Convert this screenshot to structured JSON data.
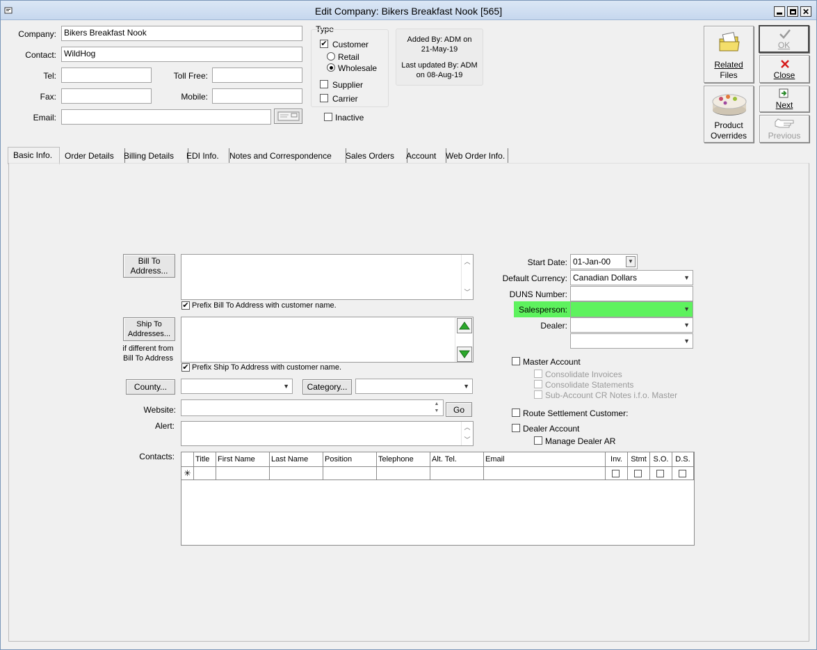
{
  "window": {
    "title": "Edit Company: Bikers Breakfast Nook [565]"
  },
  "header": {
    "company_label": "Company:",
    "company_value": "Bikers Breakfast Nook",
    "contact_label": "Contact:",
    "contact_value": "WildHog",
    "tel_label": "Tel:",
    "tel_value": "",
    "tollfree_label": "Toll Free:",
    "tollfree_value": "",
    "fax_label": "Fax:",
    "fax_value": "",
    "mobile_label": "Mobile:",
    "mobile_value": "",
    "email_label": "Email:",
    "email_value": ""
  },
  "type_group": {
    "title": "Type",
    "customer": "Customer",
    "customer_checked": "✔",
    "retail": "Retail",
    "wholesale": "Wholesale",
    "supplier": "Supplier",
    "carrier": "Carrier",
    "inactive": "Inactive"
  },
  "audit": {
    "added_by": "Added By: ADM on",
    "added_date": "21-May-19",
    "updated_by": "Last updated By: ADM",
    "updated_date": "on 08-Aug-19"
  },
  "toolbar": {
    "related_files": [
      "Related",
      "Files"
    ],
    "product_overrides": [
      "Product",
      "Overrides"
    ],
    "ok": "OK",
    "close": "Close",
    "next": "Next",
    "previous": "Previous"
  },
  "tabs": [
    "Basic Info.",
    "Order Details",
    "Billing Details",
    "EDI Info.",
    "Notes and Correspondence",
    "Sales Orders",
    "Account",
    "Web Order Info."
  ],
  "basic": {
    "bill_to_button": [
      "Bill To",
      "Address..."
    ],
    "bill_to_value": "",
    "prefix_bill": "Prefix Bill To Address with customer name.",
    "ship_to_button": [
      "Ship To",
      "Addresses..."
    ],
    "ship_to_note": [
      "if different from",
      "Bill To Address"
    ],
    "prefix_ship": "Prefix Ship To Address with customer name.",
    "county_button": "County...",
    "county_value": "",
    "category_button": "Category...",
    "category_value": "",
    "website_label": "Website:",
    "website_value": "",
    "go_button": "Go",
    "alert_label": "Alert:",
    "alert_value": "",
    "contacts_label": "Contacts:",
    "start_date_label": "Start Date:",
    "start_date_value": "01-Jan-00",
    "currency_label": "Default Currency:",
    "currency_value": "Canadian Dollars",
    "duns_label": "DUNS Number:",
    "duns_value": "",
    "salesperson_label": "Salesperson:",
    "salesperson_value": "",
    "dealer_label": "Dealer:",
    "dealer_value": "",
    "dealer2_value": "",
    "master_account": "Master Account",
    "consolidate_invoices": "Consolidate Invoices",
    "consolidate_statements": "Consolidate Statements",
    "subaccount_cr": "Sub-Account CR Notes i.f.o. Master",
    "route_settlement": "Route Settlement Customer:",
    "dealer_account": "Dealer Account",
    "manage_dealer_ar": "Manage Dealer AR"
  },
  "contacts_grid": {
    "columns": [
      "Title",
      "First Name",
      "Last Name",
      "Position",
      "Telephone",
      "Alt. Tel.",
      "Email",
      "Inv.",
      "Stmt",
      "S.O.",
      "D.S."
    ],
    "new_row_marker": "✳"
  },
  "colors": {
    "salesperson_highlight": "#5ef25e",
    "title_bar": "#c6d7ee"
  }
}
